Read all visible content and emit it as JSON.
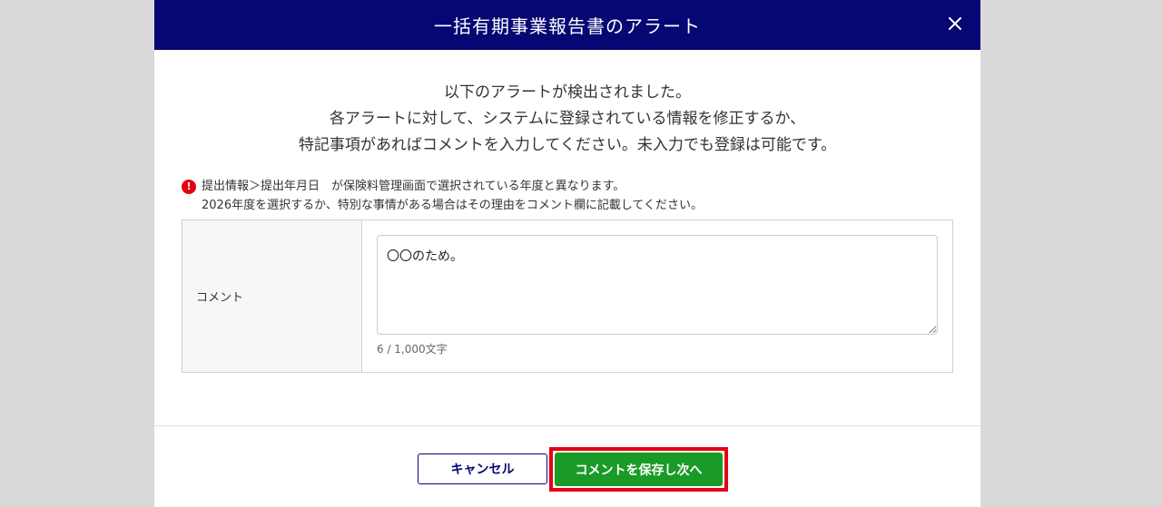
{
  "modal": {
    "title": "一括有期事業報告書のアラート",
    "close_icon": "close-icon"
  },
  "intro": {
    "line1": "以下のアラートが検出されました。",
    "line2": "各アラートに対して、システムに登録されている情報を修正するか、",
    "line3": "特記事項があればコメントを入力してください。未入力でも登録は可能です。"
  },
  "alert": {
    "icon": "alert-icon",
    "icon_glyph": "!",
    "icon_color": "#e60012",
    "line1": "提出情報＞提出年月日　が保険料管理画面で選択されている年度と異なります。",
    "line2": "2026年度を選択するか、特別な事情がある場合はその理由をコメント欄に記載してください。"
  },
  "form": {
    "comment_label": "コメント",
    "comment_value": "〇〇のため。",
    "char_count": "6 / 1,000文字"
  },
  "footer": {
    "cancel_label": "キャンセル",
    "save_label": "コメントを保存し次へ"
  },
  "colors": {
    "header_bg": "#060674",
    "save_button": "#1a9a26",
    "highlight": "#e60012"
  }
}
